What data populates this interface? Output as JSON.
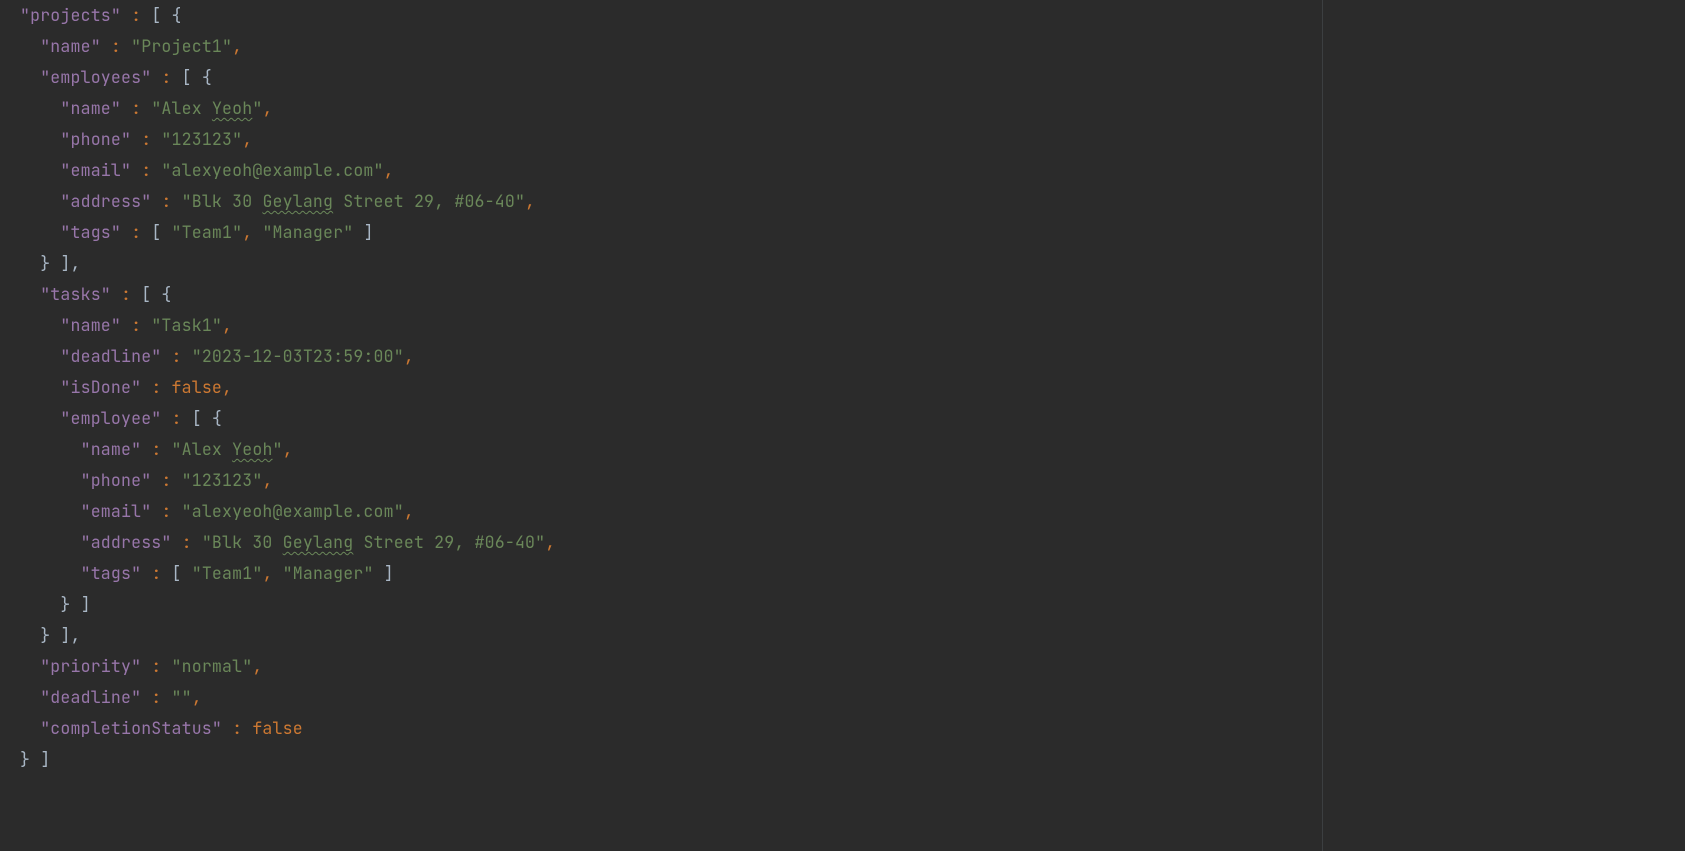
{
  "code": {
    "keys": {
      "projects": "\"projects\"",
      "name": "\"name\"",
      "employees": "\"employees\"",
      "phone": "\"phone\"",
      "email": "\"email\"",
      "address": "\"address\"",
      "tags": "\"tags\"",
      "tasks": "\"tasks\"",
      "deadline": "\"deadline\"",
      "isDone": "\"isDone\"",
      "employee": "\"employee\"",
      "priority": "\"priority\"",
      "completionStatus": "\"completionStatus\""
    },
    "values": {
      "project_name": "\"Project1\"",
      "emp_name_prefix": "\"Alex ",
      "emp_name_typo": "Yeoh",
      "emp_name_suffix": "\"",
      "phone": "\"123123\"",
      "email": "\"alexyeoh@example.com\"",
      "address_prefix": "\"Blk 30 ",
      "address_typo": "Geylang",
      "address_suffix": " Street 29, #06-40\"",
      "tag1": "\"Team1\"",
      "tag2": "\"Manager\"",
      "task_name": "\"Task1\"",
      "task_deadline": "\"2023-12-03T23:59:00\"",
      "bool_false": "false",
      "priority": "\"normal\"",
      "empty": "\"\""
    },
    "punct": {
      "colon": " : ",
      "comma": ",",
      "lbracket_lbrace": "[ {",
      "rbrace_rbracket_comma": "} ],",
      "rbrace_rbracket": "} ]",
      "lbracket_space": "[ ",
      "space_rbracket": " ]",
      "comma_space": ", "
    }
  }
}
